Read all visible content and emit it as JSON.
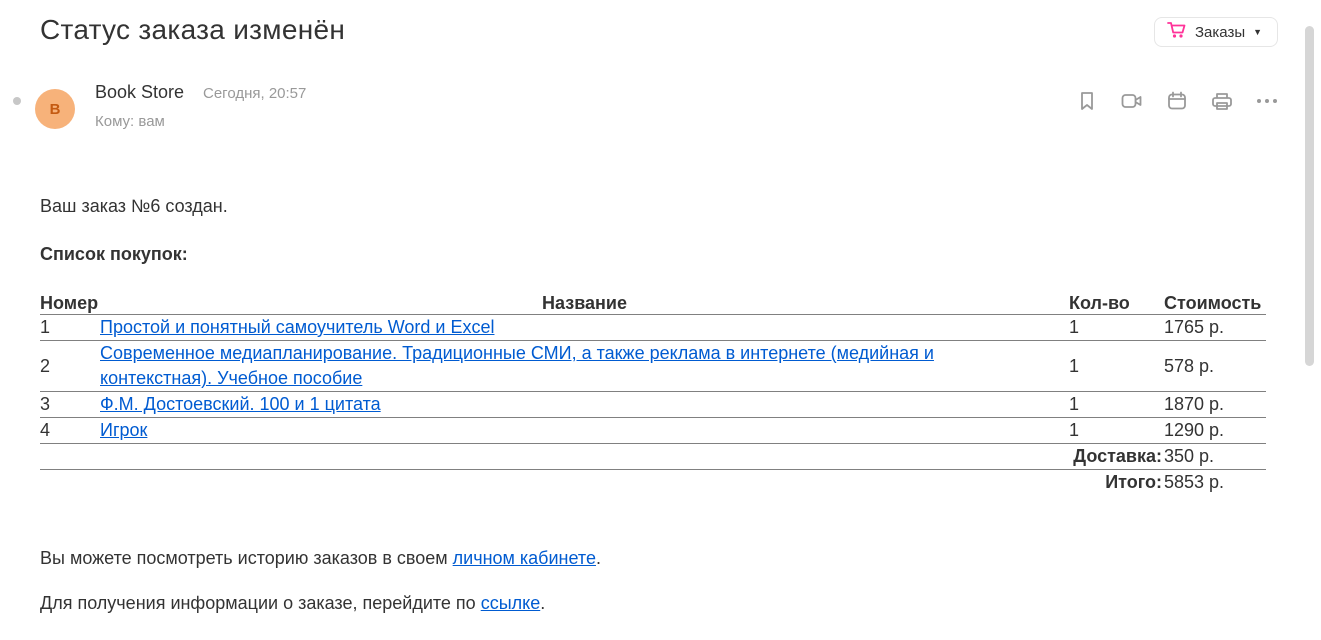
{
  "header": {
    "title": "Статус заказа изменён",
    "folder": {
      "label": "Заказы",
      "icon": "cart-icon",
      "icon_color": "#ff3399"
    }
  },
  "message": {
    "avatar_letter": "B",
    "avatar_color": "#f7b27a",
    "sender": "Book Store",
    "date": "Сегодня, 20:57",
    "to": "Кому: вам"
  },
  "toolbar": {
    "icons": [
      "bookmark-icon",
      "video-call-icon",
      "calendar-icon",
      "print-icon",
      "more-icon"
    ]
  },
  "body": {
    "created": "Ваш заказ №6 создан.",
    "list_title": "Список покупок:",
    "table": {
      "headers": {
        "num": "Номер",
        "name": "Название",
        "qty": "Кол-во",
        "cost": "Стоимость"
      },
      "rows": [
        {
          "num": "1",
          "name": "Простой и понятный самоучитель Word и Excel",
          "qty": "1",
          "cost": "1765 р."
        },
        {
          "num": "2",
          "name": "Современное медиапланирование. Традиционные СМИ, а также реклама в интернете (медийная и контекстная). Учебное пособие",
          "qty": "1",
          "cost": "578 р."
        },
        {
          "num": "3",
          "name": "Ф.М. Достоевский. 100 и 1 цитата",
          "qty": "1",
          "cost": "1870 р."
        },
        {
          "num": "4",
          "name": "Игрок",
          "qty": "1",
          "cost": "1290 р."
        }
      ],
      "delivery": {
        "label": "Доставка:",
        "value": "350 р."
      },
      "total": {
        "label": "Итого:",
        "value": "5853 р."
      }
    },
    "history": {
      "before": "Вы можете посмотреть историю заказов в своем ",
      "link": "личном кабинете",
      "after": "."
    },
    "info": {
      "before": "Для получения информации о заказе, перейдите по ",
      "link": "ссылке",
      "after": "."
    }
  },
  "colors": {
    "link": "#005bd1",
    "accent": "#ff3399"
  }
}
